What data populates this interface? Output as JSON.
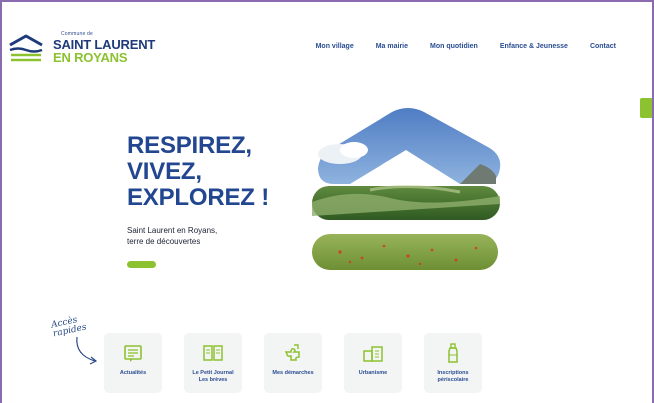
{
  "header": {
    "logo": {
      "tagline": "Commune de",
      "line1": "SAINT LAURENT",
      "line2": "EN ROYANS",
      "colors": {
        "navy": "#1f3a7a",
        "green": "#8cc230"
      }
    },
    "nav": [
      {
        "label": "Mon village"
      },
      {
        "label": "Ma mairie"
      },
      {
        "label": "Mon quotidien"
      },
      {
        "label": "Enfance & Jeunesse"
      },
      {
        "label": "Contact"
      }
    ]
  },
  "hero": {
    "lines": [
      "RESPIREZ,",
      "VIVEZ,",
      "EXPLOREZ !"
    ],
    "subtitle_line1": "Saint Laurent en Royans,",
    "subtitle_line2": "terre de découvertes",
    "accent": "#8cc230"
  },
  "quick_access": {
    "label_line1": "Accès",
    "label_line2": "rapides",
    "cards": [
      {
        "icon": "newspaper-icon",
        "label_line1": "Actualités",
        "label_line2": ""
      },
      {
        "icon": "open-book-icon",
        "label_line1": "Le Petit Journal",
        "label_line2": "Les brèves"
      },
      {
        "icon": "puzzle-icon",
        "label_line1": "Mes démarches",
        "label_line2": ""
      },
      {
        "icon": "buildings-icon",
        "label_line1": "Urbanisme",
        "label_line2": ""
      },
      {
        "icon": "bottle-icon",
        "label_line1": "Inscriptions",
        "label_line2": "périscolaire"
      }
    ]
  }
}
